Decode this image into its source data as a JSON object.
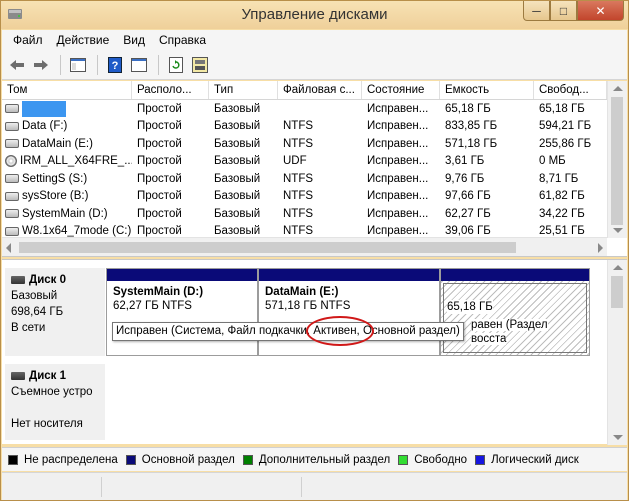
{
  "window": {
    "title": "Управление дисками"
  },
  "menu": [
    "Файл",
    "Действие",
    "Вид",
    "Справка"
  ],
  "toolbar": {
    "icons": [
      "back-arrow-icon",
      "forward-arrow-icon",
      "console-tree-icon",
      "help-icon",
      "properties-icon",
      "refresh-icon",
      "rescan-icon"
    ]
  },
  "volumes": {
    "columns": [
      "Том",
      "Располо...",
      "Тип",
      "Файловая с...",
      "Состояние",
      "Емкость",
      "Свобод..."
    ],
    "rows": [
      {
        "name": "",
        "layout": "Простой",
        "type": "Базовый",
        "fs": "",
        "status": "Исправен...",
        "capacity": "65,18 ГБ",
        "free": "65,18 ГБ",
        "icon": "drive",
        "redacted": true
      },
      {
        "name": "Data (F:)",
        "layout": "Простой",
        "type": "Базовый",
        "fs": "NTFS",
        "status": "Исправен...",
        "capacity": "833,85 ГБ",
        "free": "594,21 ГБ",
        "icon": "drive"
      },
      {
        "name": "DataMain (E:)",
        "layout": "Простой",
        "type": "Базовый",
        "fs": "NTFS",
        "status": "Исправен...",
        "capacity": "571,18 ГБ",
        "free": "255,86 ГБ",
        "icon": "drive"
      },
      {
        "name": "IRM_ALL_X64FRE_...",
        "layout": "Простой",
        "type": "Базовый",
        "fs": "UDF",
        "status": "Исправен...",
        "capacity": "3,61 ГБ",
        "free": "0 МБ",
        "icon": "cd"
      },
      {
        "name": "SettingS (S:)",
        "layout": "Простой",
        "type": "Базовый",
        "fs": "NTFS",
        "status": "Исправен...",
        "capacity": "9,76 ГБ",
        "free": "8,71 ГБ",
        "icon": "drive"
      },
      {
        "name": "sysStore (B:)",
        "layout": "Простой",
        "type": "Базовый",
        "fs": "NTFS",
        "status": "Исправен...",
        "capacity": "97,66 ГБ",
        "free": "61,82 ГБ",
        "icon": "drive"
      },
      {
        "name": "SystemMain (D:)",
        "layout": "Простой",
        "type": "Базовый",
        "fs": "NTFS",
        "status": "Исправен...",
        "capacity": "62,27 ГБ",
        "free": "34,22 ГБ",
        "icon": "drive"
      },
      {
        "name": "W8.1x64_7mode (C:)",
        "layout": "Простой",
        "type": "Базовый",
        "fs": "NTFS",
        "status": "Исправен...",
        "capacity": "39,06 ГБ",
        "free": "25,51 ГБ",
        "icon": "drive"
      }
    ]
  },
  "disks": [
    {
      "name": "Диск 0",
      "type": "Базовый",
      "size": "698,64 ГБ",
      "state": "В сети"
    },
    {
      "name": "Диск 1",
      "type": "Съемное устро",
      "size": "",
      "state": "Нет носителя"
    }
  ],
  "partitions": [
    {
      "name": "SystemMain  (D:)",
      "size": "62,27 ГБ NTFS"
    },
    {
      "name": "DataMain  (E:)",
      "size": "571,18 ГБ NTFS"
    },
    {
      "name": "",
      "size": "65,18 ГБ",
      "status_tail": "равен (Раздел восста"
    }
  ],
  "tooltip": "Исправен (Система, Файл подкачки, Активен, Основной раздел)",
  "legend": [
    {
      "label": "Не распределена",
      "color": "#000000"
    },
    {
      "label": "Основной раздел",
      "color": "#0a0a78"
    },
    {
      "label": "Дополнительный раздел",
      "color": "#008000"
    },
    {
      "label": "Свободно",
      "color": "#33dd33"
    },
    {
      "label": "Логический диск",
      "color": "#1414e0"
    }
  ],
  "colors": {
    "accent_ellipse": "#d01818",
    "redaction": "#3c96f0"
  }
}
